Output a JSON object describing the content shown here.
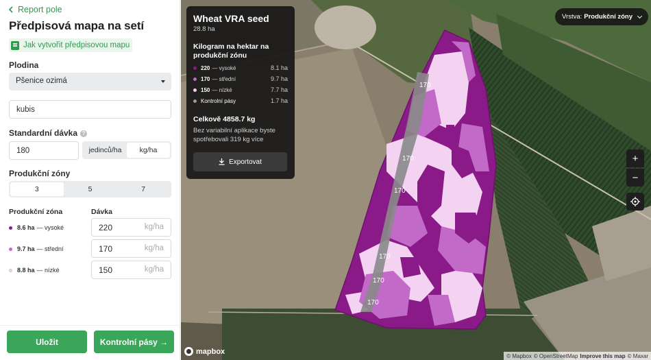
{
  "panel": {
    "back_label": "Report pole",
    "title": "Předpisová mapa na setí",
    "howto_label": "Jak vytvořit předpisovou mapu",
    "crop_label": "Plodina",
    "crop_value": "Pšenice ozimá",
    "variety_value": "kubis",
    "std_dose_label": "Standardní dávka",
    "std_dose_value": "180",
    "unit_options": [
      "jedinců/ha",
      "kg/ha"
    ],
    "unit_selected": "kg/ha",
    "zones_label": "Produkční zóny",
    "zone_count_options": [
      "3",
      "5",
      "7"
    ],
    "zone_count_selected": "3",
    "zone_col_label": "Produkční zóna",
    "dose_col_label": "Dávka",
    "zones": [
      {
        "area": "8.6 ha",
        "name": "— vysoké",
        "dose": "220",
        "unit": "kg/ha",
        "color": "#8b1a89"
      },
      {
        "area": "9.7 ha",
        "name": "— střední",
        "dose": "170",
        "unit": "kg/ha",
        "color": "#c26ac8"
      },
      {
        "area": "8.8 ha",
        "name": "— nízké",
        "dose": "150",
        "unit": "kg/ha",
        "color": "#f3d2f2"
      }
    ],
    "save_label": "Uložit",
    "control_strips_label": "Kontrolní pásy →"
  },
  "map": {
    "card": {
      "title": "Wheat VRA seed",
      "area": "28.8 ha",
      "heading": "Kilogram na hektar na produkční zónu",
      "legend": [
        {
          "value": "220",
          "name": "— vysoké",
          "ha": "8.1 ha",
          "color": "#8b1a89"
        },
        {
          "value": "170",
          "name": "— střední",
          "ha": "9.7 ha",
          "color": "#c26ac8"
        },
        {
          "value": "150",
          "name": "— nízké",
          "ha": "7.7 ha",
          "color": "#f3d2f2"
        },
        {
          "value": "",
          "name": "Kontrolní pásy",
          "ha": "1.7 ha",
          "color": "#9a9a9a"
        }
      ],
      "total": "Celkově 4858.7 kg",
      "note": "Bez variabilní aplikace byste spotřebovali 319 kg více",
      "export_label": "Exportovat"
    },
    "layer_prefix": "Vrstva:",
    "layer_value": "Produkční zóny",
    "zoom_in": "+",
    "zoom_out": "−",
    "strip_labels": [
      "170",
      "170",
      "170",
      "170",
      "170",
      "170"
    ],
    "logo_text": "mapbox",
    "attribution": {
      "a": "© Mapbox",
      "b": "© OpenStreetMap",
      "c": "Improve this map",
      "d": "© Maxar"
    }
  }
}
